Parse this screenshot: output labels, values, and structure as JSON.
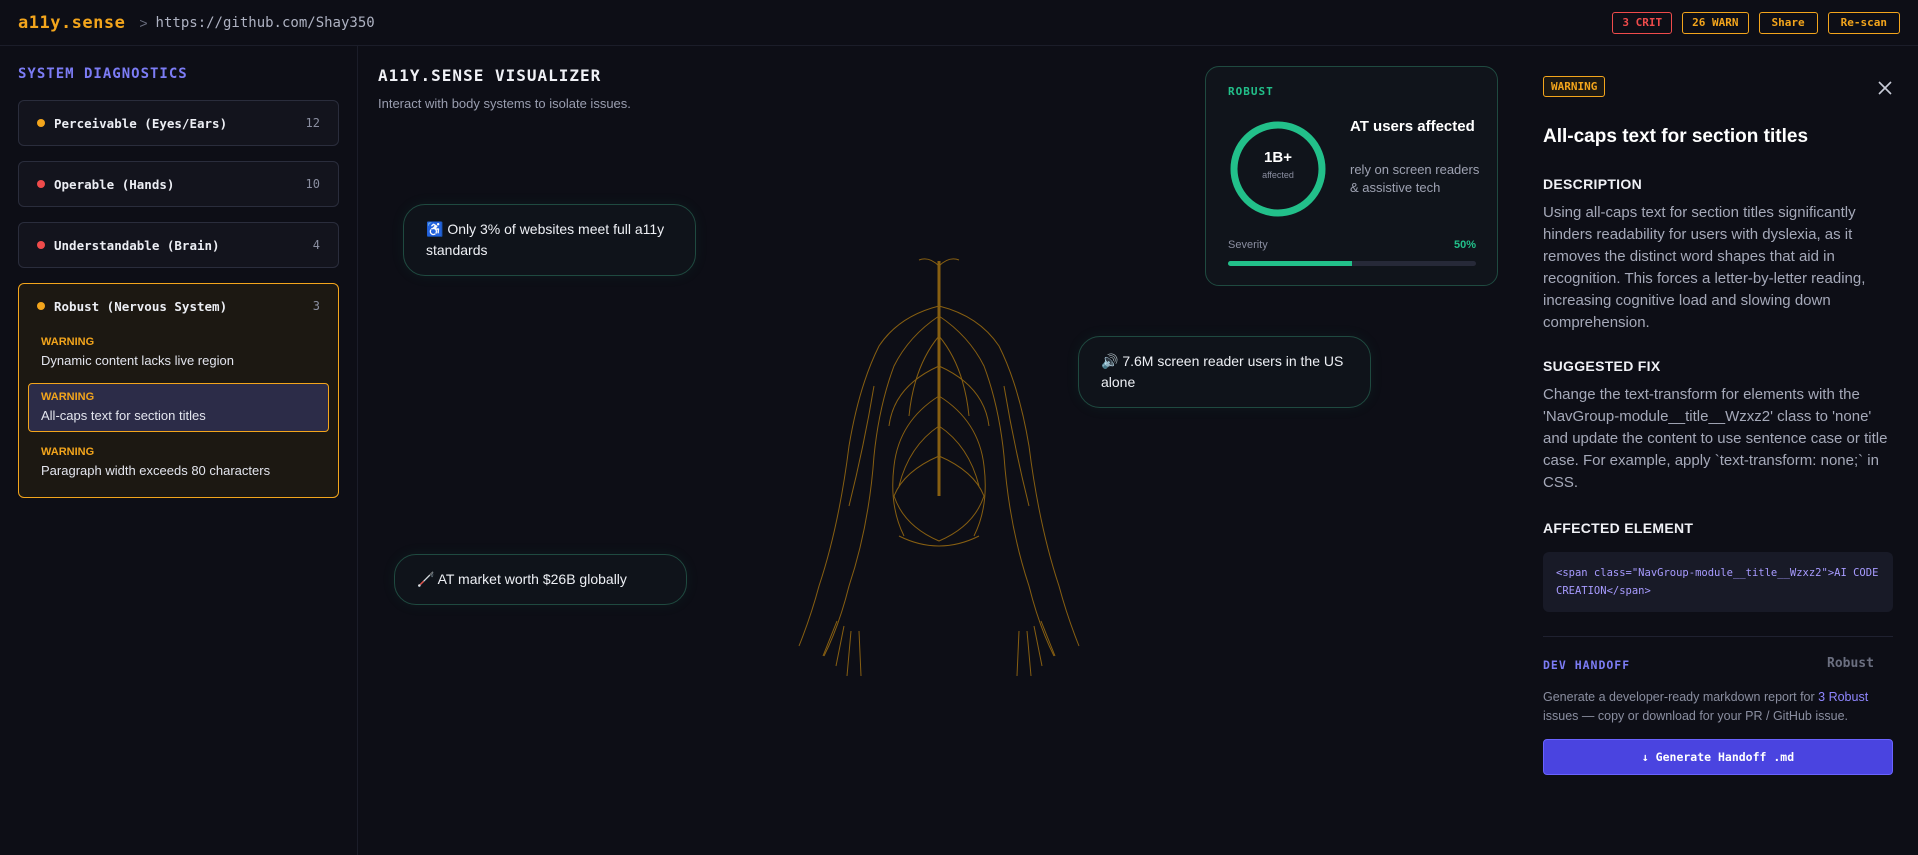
{
  "header": {
    "brand": "a11y.sense",
    "separator": ">",
    "url": "https://github.com/Shay350",
    "crit_badge": "3 CRIT",
    "warn_badge": "26 WARN",
    "share_label": "Share",
    "rescan_label": "Re-scan"
  },
  "sidebar": {
    "title": "SYSTEM DIAGNOSTICS",
    "groups": [
      {
        "label": "Perceivable (Eyes/Ears)",
        "count": "12",
        "dot_color": "#f3a51c"
      },
      {
        "label": "Operable (Hands)",
        "count": "10",
        "dot_color": "#ef4b4b"
      },
      {
        "label": "Understandable (Brain)",
        "count": "4",
        "dot_color": "#ef4b4b"
      },
      {
        "label": "Robust (Nervous System)",
        "count": "3",
        "dot_color": "#f3a51c",
        "issues": [
          {
            "severity": "WARNING",
            "text": "Dynamic content lacks live region"
          },
          {
            "severity": "WARNING",
            "text": "All-caps text for section titles"
          },
          {
            "severity": "WARNING",
            "text": "Paragraph width exceeds 80 characters"
          }
        ]
      }
    ]
  },
  "visualizer": {
    "title": "A11Y.SENSE VISUALIZER",
    "subtitle": "Interact with body systems to isolate issues.",
    "stats": [
      {
        "icon": "♿",
        "text": "Only 3% of websites meet full a11y standards"
      },
      {
        "icon": "🔊",
        "text": "7.6M screen reader users in the US alone"
      },
      {
        "icon": "🦯",
        "text": "AT market worth $26B globally"
      }
    ],
    "card": {
      "label": "ROBUST",
      "ring_value": "1B+",
      "ring_caption": "affected",
      "heading": "AT users affected",
      "description": "rely on screen readers & assistive tech",
      "severity_label": "Severity",
      "severity_pct": "50%",
      "severity_value": 0.5
    }
  },
  "panel": {
    "badge": "WARNING",
    "title": "All-caps text for section titles",
    "description_heading": "DESCRIPTION",
    "description": "Using all-caps text for section titles significantly hinders readability for users with dyslexia, as it removes the distinct word shapes that aid in recognition. This forces a letter-by-letter reading, increasing cognitive load and slowing down comprehension.",
    "fix_heading": "SUGGESTED FIX",
    "fix": "Change the text-transform for elements with the 'NavGroup-module__title__Wzxz2' class to 'none' and update the content to use sentence case or title case. For example, apply `text-transform: none;` in CSS.",
    "element_heading": "AFFECTED ELEMENT",
    "element_code": "<span class=\"NavGroup-module__title__Wzxz2\">AI CODE CREATION</span>",
    "handoff_heading": "DEV HANDOFF",
    "handoff_tag": "Robust",
    "handoff_text_1": "Generate a developer-ready markdown report for ",
    "handoff_highlight": "3 Robust",
    "handoff_text_2": " issues — copy or download for your PR / GitHub issue.",
    "generate_label": "↓ Generate Handoff .md"
  },
  "colors": {
    "accent_orange": "#f3a51c",
    "crit_red": "#ef4b4b",
    "accent_purple": "#7c7cf5",
    "green": "#22c08a"
  }
}
